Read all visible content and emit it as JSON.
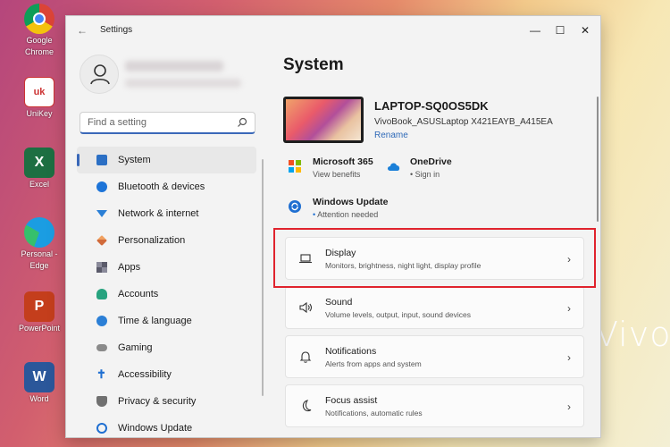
{
  "desktop": {
    "icons": [
      {
        "name": "Google Chrome",
        "lines": [
          "Google",
          "Chrome"
        ],
        "color": "#ffffff"
      },
      {
        "name": "UniKey",
        "lines": [
          "UniKey"
        ],
        "color": "#ffffff"
      },
      {
        "name": "Excel",
        "lines": [
          "Excel"
        ],
        "color": "#1d6f42"
      },
      {
        "name": "Personal - Edge",
        "lines": [
          "Personal -",
          "Edge"
        ],
        "color": "#1f7fc4"
      },
      {
        "name": "PowerPoint",
        "lines": [
          "PowerPoint"
        ],
        "color": "#c43e1c"
      },
      {
        "name": "Word",
        "lines": [
          "Word"
        ],
        "color": "#2b579a"
      }
    ],
    "wallpaper_text": "VivoB"
  },
  "window": {
    "title": "Settings",
    "back_icon": "arrow-left-icon",
    "minimize": "—",
    "maximize": "☐",
    "close": "✕"
  },
  "search": {
    "placeholder": "Find a setting"
  },
  "sidebar": {
    "items": [
      {
        "label": "System",
        "icon": "monitor-icon",
        "color": "#2b6fc4",
        "active": true
      },
      {
        "label": "Bluetooth & devices",
        "icon": "bluetooth-icon",
        "color": "#1d74d8",
        "active": false
      },
      {
        "label": "Network & internet",
        "icon": "wifi-icon",
        "color": "#2a7fd6",
        "active": false
      },
      {
        "label": "Personalization",
        "icon": "brush-icon",
        "color": "#d16a3a",
        "active": false
      },
      {
        "label": "Apps",
        "icon": "apps-icon",
        "color": "#5a5a6a",
        "active": false
      },
      {
        "label": "Accounts",
        "icon": "person-icon",
        "color": "#27a37f",
        "active": false
      },
      {
        "label": "Time & language",
        "icon": "globe-clock-icon",
        "color": "#2b7fd6",
        "active": false
      },
      {
        "label": "Gaming",
        "icon": "gamepad-icon",
        "color": "#7a7a7a",
        "active": false
      },
      {
        "label": "Accessibility",
        "icon": "accessibility-icon",
        "color": "#1f6fd1",
        "active": false
      },
      {
        "label": "Privacy & security",
        "icon": "shield-icon",
        "color": "#707070",
        "active": false
      },
      {
        "label": "Windows Update",
        "icon": "update-icon",
        "color": "#1f6fd1",
        "active": false
      }
    ]
  },
  "main": {
    "title": "System",
    "device": {
      "name": "LAPTOP-SQ0OS5DK",
      "model": "VivoBook_ASUSLaptop X421EAYB_A415EA",
      "rename": "Rename"
    },
    "quick": [
      {
        "title": "Microsoft 365",
        "subtitle": "View benefits",
        "icon": "microsoft-logo-icon"
      },
      {
        "title": "OneDrive",
        "subtitle": "Sign in",
        "icon": "cloud-icon"
      },
      {
        "title": "Windows Update",
        "subtitle": "Attention needed",
        "icon": "update-icon"
      }
    ],
    "cards": [
      {
        "title": "Display",
        "subtitle": "Monitors, brightness, night light, display profile",
        "icon": "laptop-icon"
      },
      {
        "title": "Sound",
        "subtitle": "Volume levels, output, input, sound devices",
        "icon": "speaker-icon"
      },
      {
        "title": "Notifications",
        "subtitle": "Alerts from apps and system",
        "icon": "bell-icon"
      },
      {
        "title": "Focus assist",
        "subtitle": "Notifications, automatic rules",
        "icon": "moon-icon"
      }
    ],
    "chevron": "›",
    "bullet": "•"
  },
  "highlight_color": "#e0232d"
}
